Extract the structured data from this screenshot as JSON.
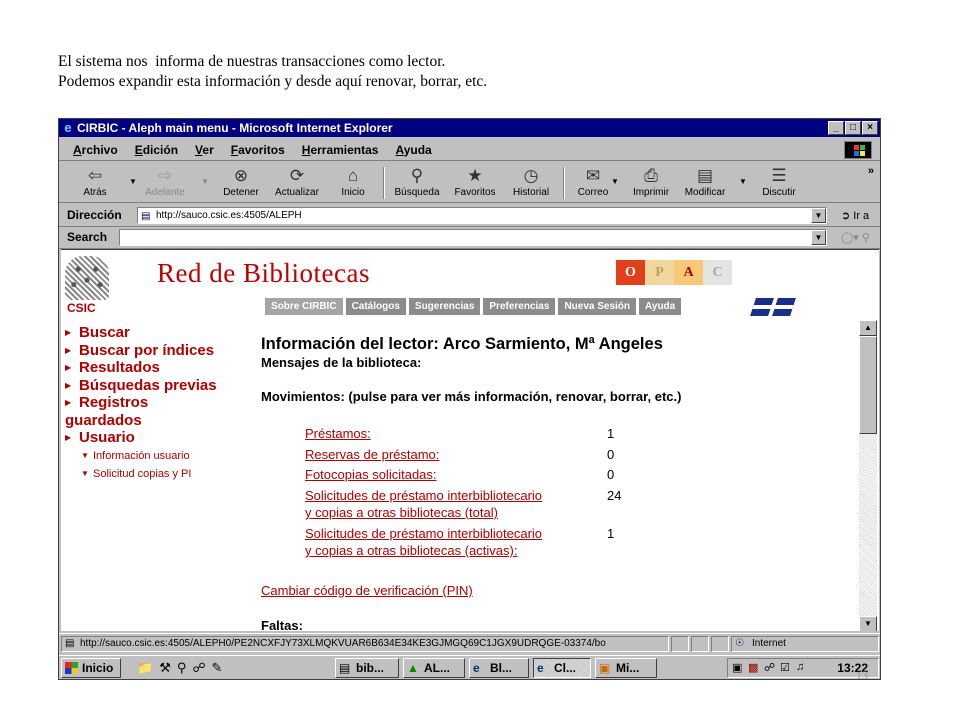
{
  "caption": {
    "line1": "El sistema nos  informa de nuestras transacciones como lector.",
    "line2": "Podemos expandir esta información y desde aquí renovar, borrar, etc."
  },
  "slide_number": "13",
  "window": {
    "title": "CIRBIC - Aleph main menu - Microsoft Internet Explorer",
    "controls": [
      "_",
      "□",
      "×"
    ]
  },
  "menubar": [
    "Archivo",
    "Edición",
    "Ver",
    "Favoritos",
    "Herramientas",
    "Ayuda"
  ],
  "toolbar": {
    "back": "Atrás",
    "forward": "Adelante",
    "stop": "Detener",
    "refresh": "Actualizar",
    "home": "Inicio",
    "search": "Búsqueda",
    "favorites": "Favoritos",
    "history": "Historial",
    "mail": "Correo",
    "print": "Imprimir",
    "edit": "Modificar",
    "discuss": "Discutir"
  },
  "address": {
    "label": "Dirección",
    "url": "http://sauco.csic.es:4505/ALEPH",
    "go": "Ir a"
  },
  "searchbar": {
    "label": "Search",
    "value": ""
  },
  "page": {
    "logo_text": "CSIC",
    "site_title": "Red de Bibliotecas",
    "opac": [
      {
        "letter": "O",
        "bg": "#e0401a",
        "fg": "#ffffff"
      },
      {
        "letter": "P",
        "bg": "#f0d7a0",
        "fg": "#c0a060"
      },
      {
        "letter": "A",
        "bg": "#f7c977",
        "fg": "#b00000"
      },
      {
        "letter": "C",
        "bg": "#e4e4e4",
        "fg": "#a8a8a8"
      }
    ],
    "nav_tabs": [
      "Sobre CIRBIC",
      "Catálogos",
      "Sugerencias",
      "Preferencias",
      "Nueva Sesión",
      "Ayuda"
    ],
    "left_menu": {
      "buscar": "Buscar",
      "buscar_indices": "Buscar por índices",
      "resultados": "Resultados",
      "busquedas_previas": "Búsquedas previas",
      "registros": "Registros",
      "guardados": "guardados",
      "usuario": "Usuario",
      "info_usuario": "Información usuario",
      "solicitud_copias": "Solicitud copias y PI"
    },
    "heading": "Información del lector: Arco Sarmiento, Mª Angeles",
    "mensajes": "Mensajes de la biblioteca:",
    "movimientos": "Movimientos: (pulse para ver más información, renovar, borrar, etc.)",
    "transactions": [
      {
        "line1": "Préstamos:",
        "line2": "",
        "value": "1"
      },
      {
        "line1": "Reservas de préstamo:",
        "line2": "",
        "value": "0"
      },
      {
        "line1": "Fotocopias solicitadas:",
        "line2": "",
        "value": "0"
      },
      {
        "line1": "Solicitudes de préstamo interbibliotecario",
        "line2": "y copias a otras bibliotecas (total)",
        "value": "24"
      },
      {
        "line1": "Solicitudes de préstamo interbibliotecario",
        "line2": "y copias a otras bibliotecas (activas):",
        "value": "1"
      }
    ],
    "pin_link": "Cambiar código de verificación (PIN)",
    "faltas": "Faltas:"
  },
  "statusbar": {
    "url": "http://sauco.csic.es:4505/ALEPH0/PE2NCXFJY73XLMQKVUAR6B634E34KE3GJMGQ69C1JGX9UDRQGE-03374/bo",
    "zone": "Internet"
  },
  "taskbar": {
    "start": "Inicio",
    "tasks": [
      "bib...",
      "AL...",
      "Bl...",
      "Cl...",
      "Mi..."
    ],
    "clock": "13:22"
  }
}
